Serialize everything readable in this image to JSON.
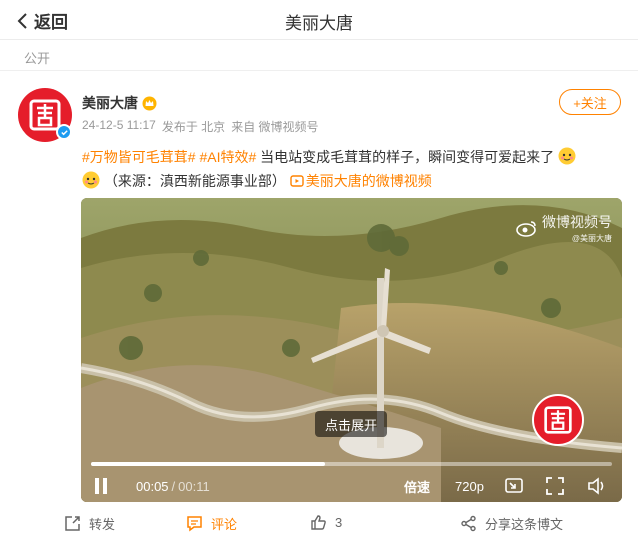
{
  "nav": {
    "back_label": "返回",
    "title": "美丽大唐"
  },
  "visibility": "公开",
  "post": {
    "author": "美丽大唐",
    "timestamp": "24-12-5 11:17",
    "location": "发布于 北京",
    "source": "来自 微博视频号",
    "follow_label": "+关注",
    "text_parts": {
      "tag1": "#万物皆可毛茸茸#",
      "tag2": "#AI特效#",
      "body1": " 当电站变成毛茸茸的样子，瞬间变得可爱起来了",
      "body2": "（来源：滇西新能源事业部）",
      "video_link": "美丽大唐的微博视频"
    }
  },
  "video": {
    "watermark_title": "微博视频号",
    "watermark_handle": "@美丽大唐",
    "expand_label": "点击展开",
    "current_time": "00:05",
    "separator": "/",
    "duration": "00:11",
    "progress": 0.45,
    "speed_label": "倍速",
    "quality_label": "720p"
  },
  "actions": {
    "repost_label": "转发",
    "comment_label": "评论",
    "like_count": "3",
    "share_label": "分享这条博文"
  },
  "colors": {
    "accent": "#ff8200",
    "brand_red": "#e51d2a",
    "verified_blue": "#1d9bf0"
  },
  "icons": [
    "chevron-left-icon",
    "crown-icon",
    "verified-icon",
    "video-icon",
    "play-icon",
    "pip-icon",
    "fullscreen-icon",
    "volume-icon",
    "repost-icon",
    "comment-icon",
    "like-icon",
    "share-icon"
  ]
}
